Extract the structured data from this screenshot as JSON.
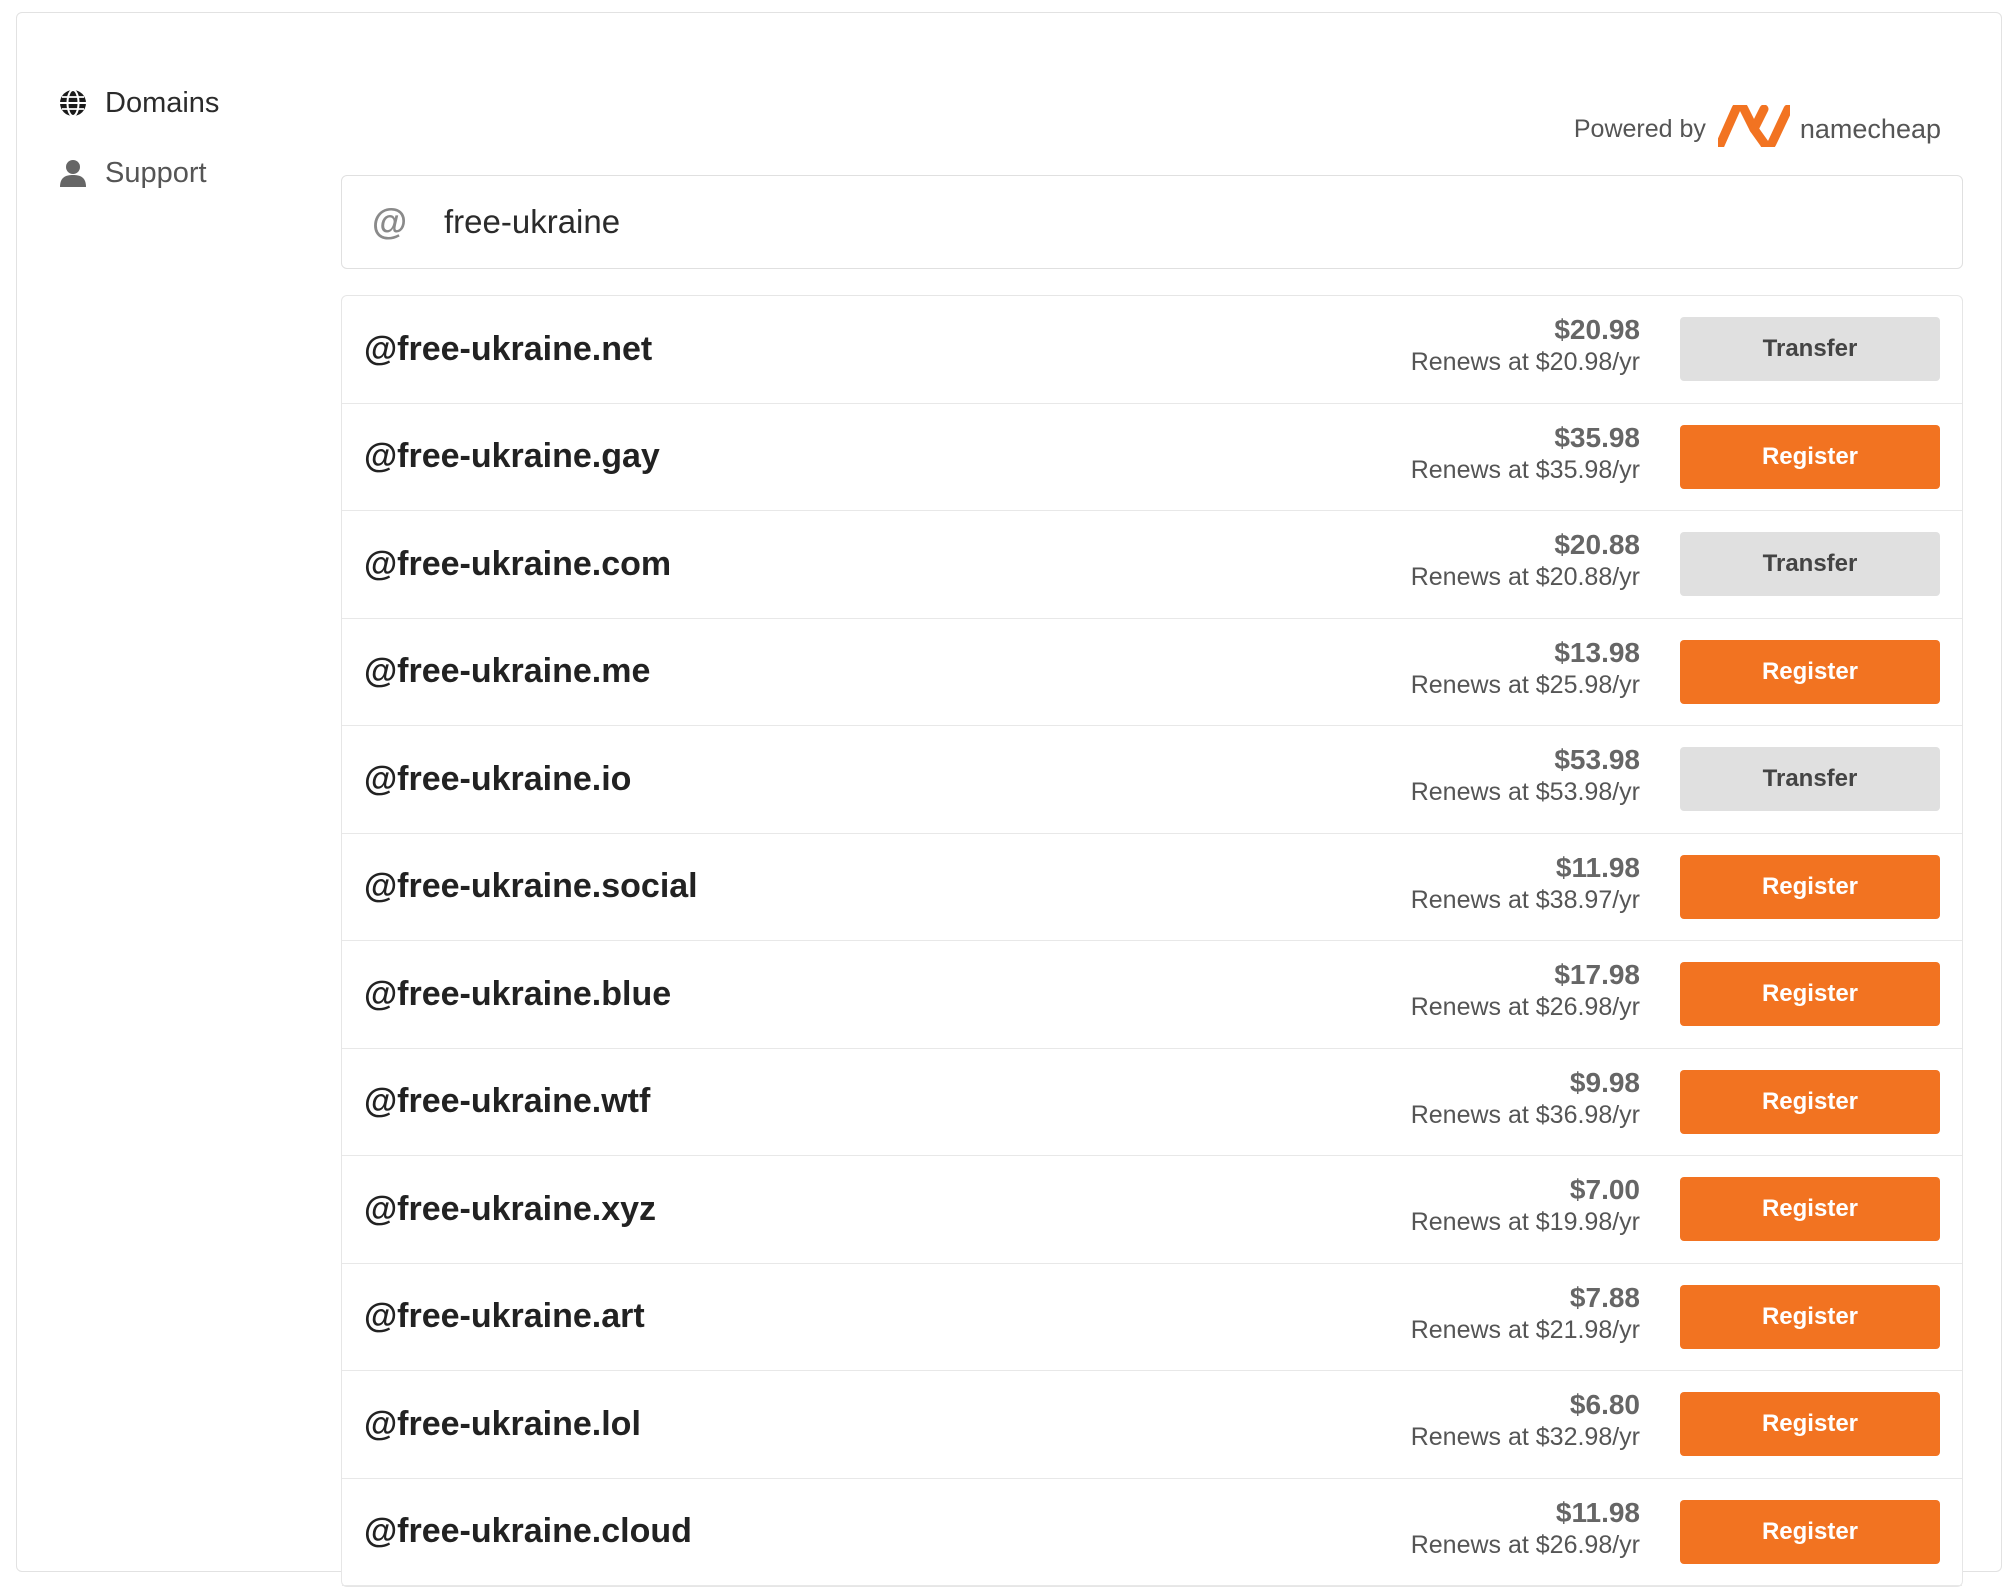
{
  "sidebar": {
    "items": [
      {
        "label": "Domains",
        "icon": "globe-icon",
        "active": true
      },
      {
        "label": "Support",
        "icon": "user-icon",
        "active": false
      }
    ]
  },
  "powered": {
    "prefix": "Powered by",
    "brand": "namecheap",
    "logo_color": "#f27321"
  },
  "search": {
    "prefix": "@",
    "value": "free-ukraine"
  },
  "colors": {
    "register": "#f27321",
    "transfer": "#e0e0e0"
  },
  "results": [
    {
      "domain": "@free-ukraine.net",
      "price": "$20.98",
      "renew": "Renews at $20.98/yr",
      "action": "Transfer"
    },
    {
      "domain": "@free-ukraine.gay",
      "price": "$35.98",
      "renew": "Renews at $35.98/yr",
      "action": "Register"
    },
    {
      "domain": "@free-ukraine.com",
      "price": "$20.88",
      "renew": "Renews at $20.88/yr",
      "action": "Transfer"
    },
    {
      "domain": "@free-ukraine.me",
      "price": "$13.98",
      "renew": "Renews at $25.98/yr",
      "action": "Register"
    },
    {
      "domain": "@free-ukraine.io",
      "price": "$53.98",
      "renew": "Renews at $53.98/yr",
      "action": "Transfer"
    },
    {
      "domain": "@free-ukraine.social",
      "price": "$11.98",
      "renew": "Renews at $38.97/yr",
      "action": "Register"
    },
    {
      "domain": "@free-ukraine.blue",
      "price": "$17.98",
      "renew": "Renews at $26.98/yr",
      "action": "Register"
    },
    {
      "domain": "@free-ukraine.wtf",
      "price": "$9.98",
      "renew": "Renews at $36.98/yr",
      "action": "Register"
    },
    {
      "domain": "@free-ukraine.xyz",
      "price": "$7.00",
      "renew": "Renews at $19.98/yr",
      "action": "Register"
    },
    {
      "domain": "@free-ukraine.art",
      "price": "$7.88",
      "renew": "Renews at $21.98/yr",
      "action": "Register"
    },
    {
      "domain": "@free-ukraine.lol",
      "price": "$6.80",
      "renew": "Renews at $32.98/yr",
      "action": "Register"
    },
    {
      "domain": "@free-ukraine.cloud",
      "price": "$11.98",
      "renew": "Renews at $26.98/yr",
      "action": "Register"
    }
  ]
}
